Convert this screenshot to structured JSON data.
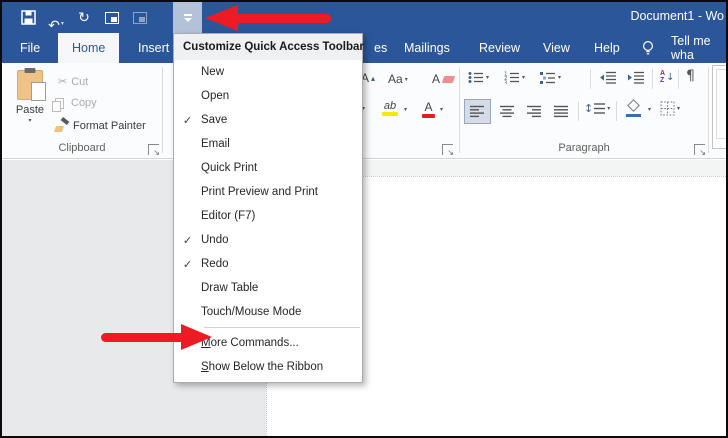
{
  "window": {
    "title": "Document1 - Wo"
  },
  "titlebar": {
    "qat_icons": [
      "save",
      "undo",
      "redo",
      "screen-mode",
      "screen-mode-dim"
    ],
    "customize_button": "quick-access-toolbar-dropdown"
  },
  "tabs": {
    "left": [
      {
        "label": "File"
      },
      {
        "label": "Home",
        "active": true
      },
      {
        "label": "Insert"
      }
    ],
    "right": [
      {
        "label": "es"
      },
      {
        "label": "Mailings"
      },
      {
        "label": "Review"
      },
      {
        "label": "View"
      },
      {
        "label": "Help"
      }
    ],
    "tell_me": "Tell me wha"
  },
  "ribbon": {
    "clipboard": {
      "label": "Clipboard",
      "paste": "Paste",
      "cut": "Cut",
      "copy": "Copy",
      "format_painter": "Format Painter"
    },
    "font": {
      "grow_font": "A",
      "change_case": "Aa",
      "clear_formatting": "A",
      "highlight": "ab",
      "font_color": "A"
    },
    "paragraph": {
      "label": "Paragraph",
      "sort_a": "A",
      "sort_z": "Z",
      "pilcrow": "¶"
    }
  },
  "menu": {
    "header": "Customize Quick Access Toolbar",
    "items": [
      {
        "label": "New"
      },
      {
        "label": "Open"
      },
      {
        "label": "Save",
        "checked": true
      },
      {
        "label": "Email"
      },
      {
        "label": "Quick Print"
      },
      {
        "label": "Print Preview and Print"
      },
      {
        "label": "Editor (F7)"
      },
      {
        "label": "Undo",
        "checked": true
      },
      {
        "label": "Redo",
        "checked": true
      },
      {
        "label": "Draw Table"
      },
      {
        "label": "Touch/Mouse Mode"
      },
      {
        "separator": true
      },
      {
        "label": "More Commands...",
        "accel": true
      },
      {
        "label": "Show Below the Ribbon",
        "accel": true
      }
    ]
  },
  "colors": {
    "titlebar_blue": "#2b579a",
    "qat_button_highlight": "#b3c2d9",
    "arrow_red": "#ed1c24",
    "doc_gray": "#e8e9eb",
    "active_tab_text": "#2b579a"
  }
}
